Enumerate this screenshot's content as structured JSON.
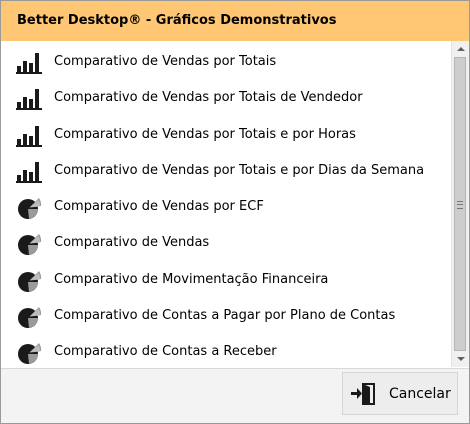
{
  "window": {
    "title": "Better Desktop® - Gráficos Demonstrativos"
  },
  "list": {
    "items": [
      {
        "label": "Comparativo de Vendas por Totais",
        "icon": "bar-chart-icon"
      },
      {
        "label": "Comparativo de Vendas por Totais de Vendedor",
        "icon": "bar-chart-icon"
      },
      {
        "label": "Comparativo de Vendas por Totais e por Horas",
        "icon": "bar-chart-icon"
      },
      {
        "label": "Comparativo de Vendas por Totais e por Dias da Semana",
        "icon": "bar-chart-icon"
      },
      {
        "label": "Comparativo de Vendas por ECF",
        "icon": "pie-chart-icon"
      },
      {
        "label": "Comparativo de Vendas",
        "icon": "pie-chart-icon"
      },
      {
        "label": "Comparativo de Movimentação Financeira",
        "icon": "pie-chart-icon"
      },
      {
        "label": "Comparativo de Contas a Pagar por Plano de Contas",
        "icon": "pie-chart-icon"
      },
      {
        "label": "Comparativo de Contas a Receber",
        "icon": "pie-chart-icon"
      }
    ]
  },
  "footer": {
    "cancel_label": "Cancelar",
    "cancel_icon": "exit-door-icon"
  },
  "colors": {
    "title_bar": "#ffc773",
    "icon_dark": "#1a1a1a",
    "icon_grey": "#9a9a9a"
  }
}
